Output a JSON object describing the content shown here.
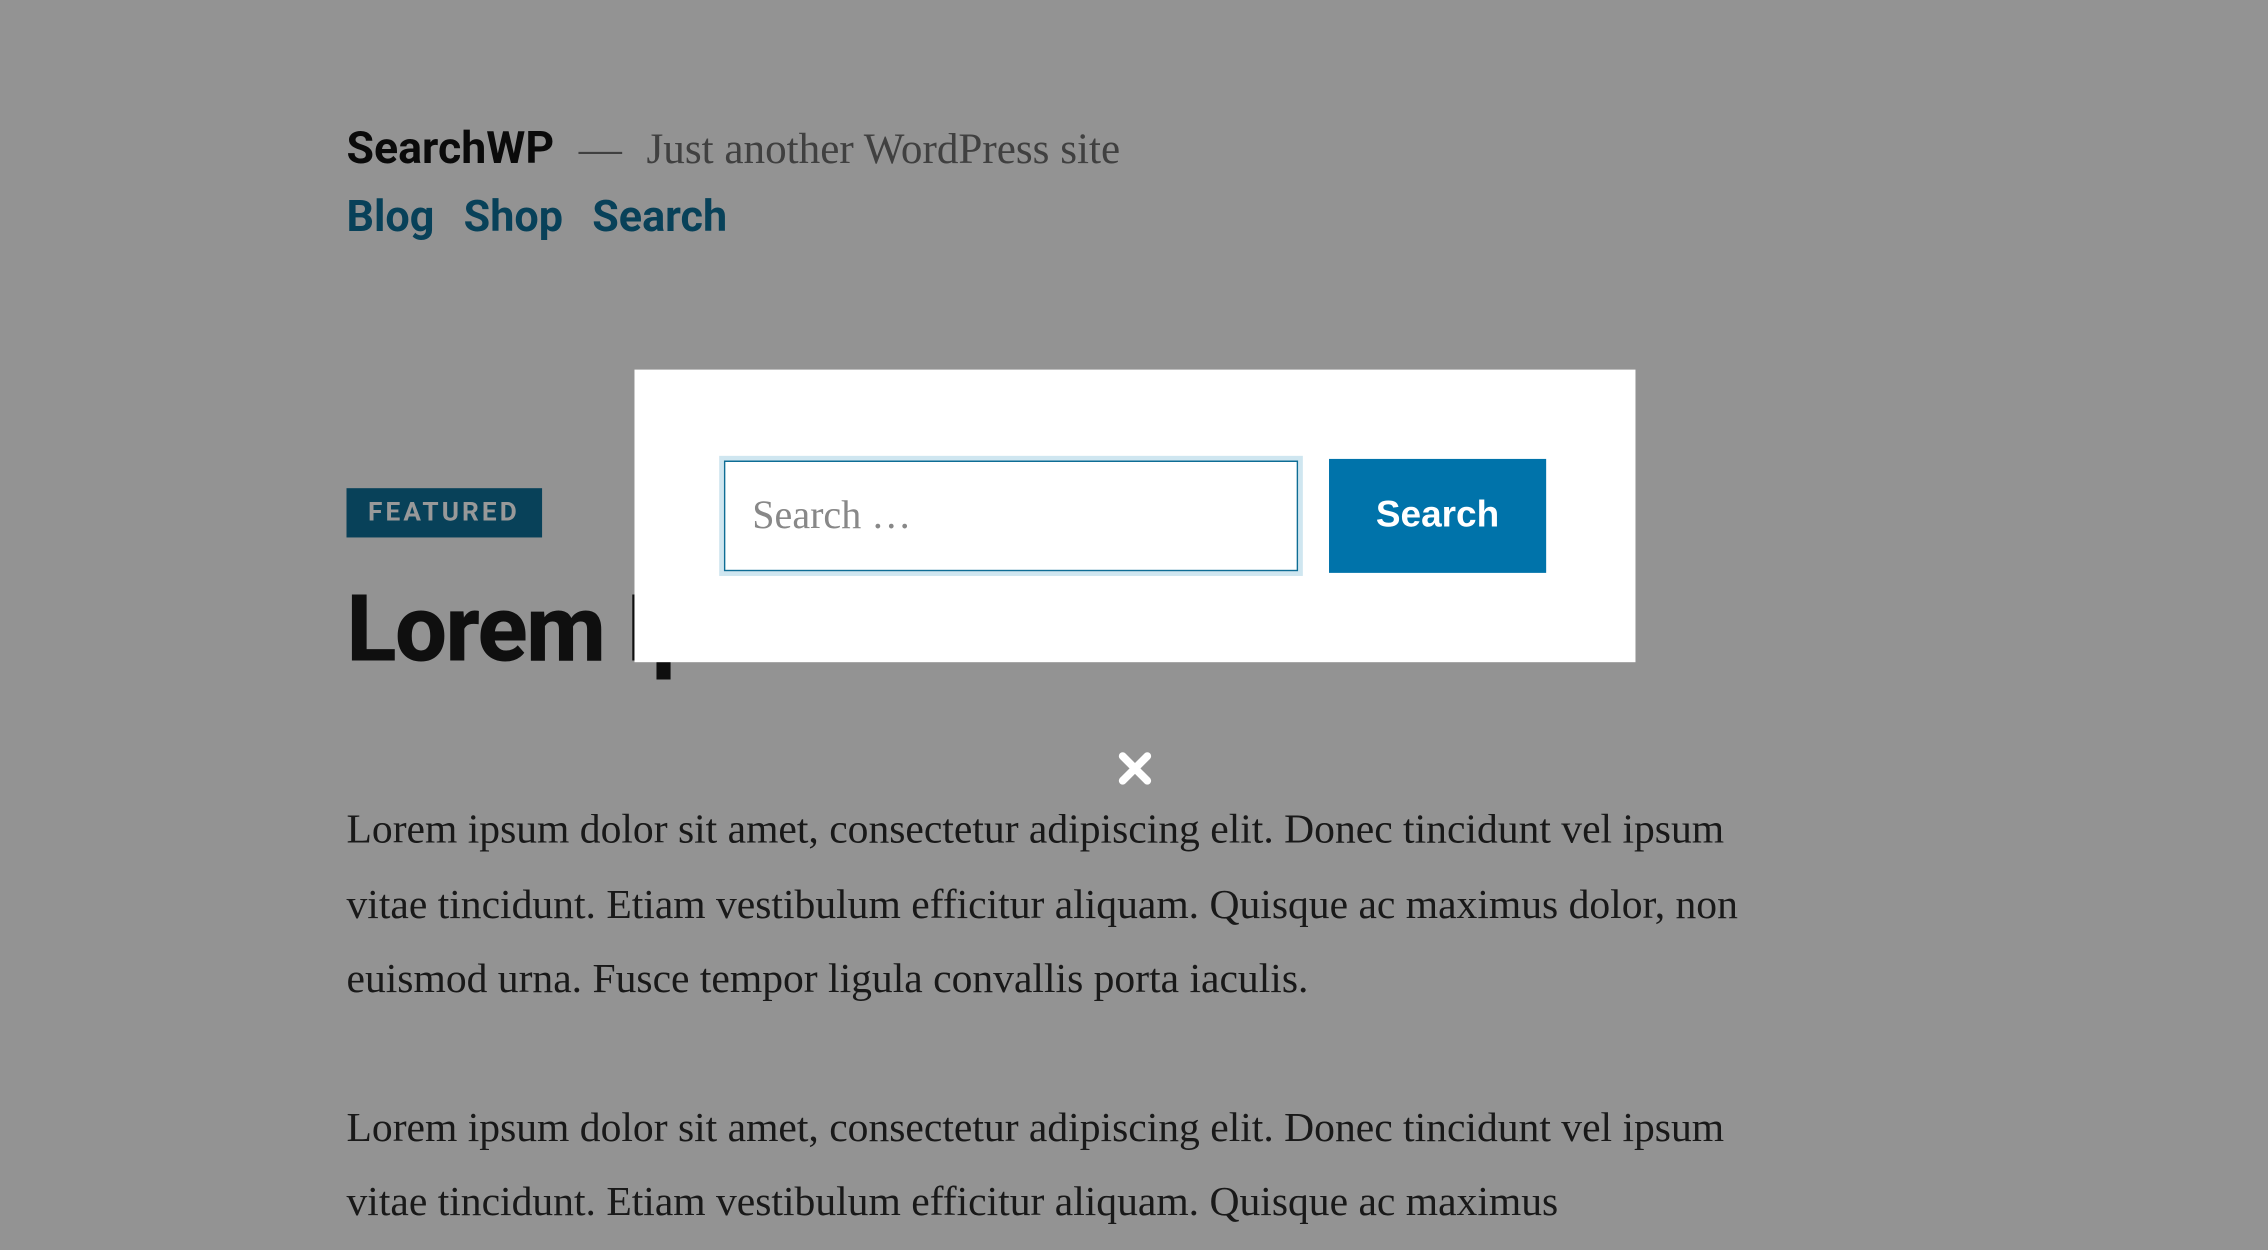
{
  "header": {
    "site_title": "SearchWP",
    "dash": "—",
    "tagline": "Just another WordPress site"
  },
  "nav": {
    "items": [
      {
        "label": "Blog"
      },
      {
        "label": "Shop"
      },
      {
        "label": "Search"
      }
    ]
  },
  "post": {
    "featured_label": "FEATURED",
    "title": "Lorem Ipsum",
    "paragraphs": [
      "Lorem ipsum dolor sit amet, consectetur adipiscing elit. Donec tincidunt vel ipsum vitae tincidunt. Etiam vestibulum efficitur aliquam. Quisque ac maximus dolor, non euismod urna. Fusce tempor ligula convallis porta iaculis.",
      "Lorem ipsum dolor sit amet, consectetur adipiscing elit. Donec tincidunt vel ipsum vitae tincidunt. Etiam vestibulum efficitur aliquam. Quisque ac maximus"
    ]
  },
  "modal": {
    "search_placeholder": "Search …",
    "search_button": "Search"
  }
}
